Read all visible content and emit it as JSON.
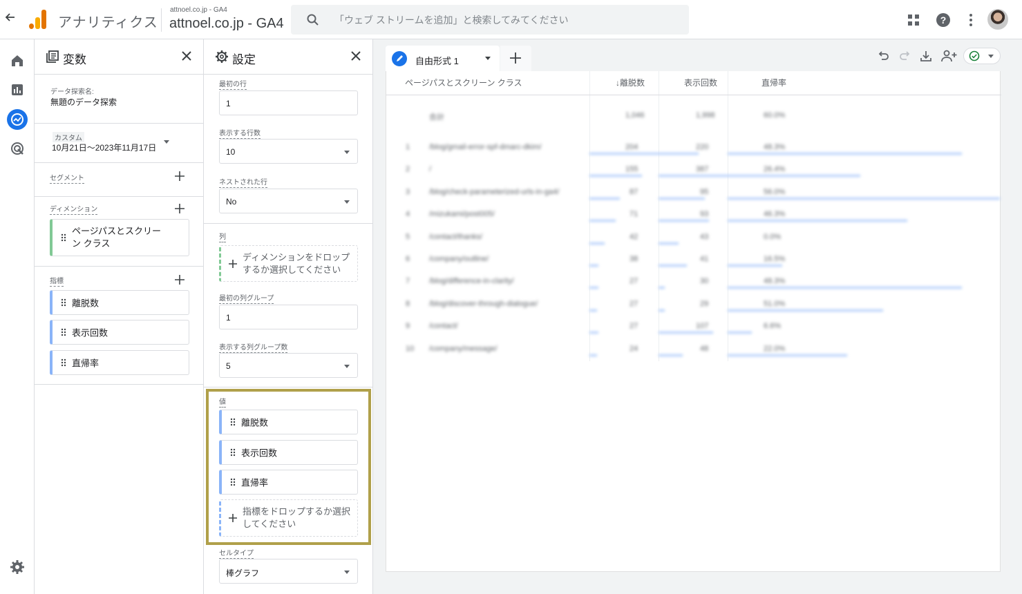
{
  "topbar": {
    "app_name": "アナリティクス",
    "account_small": "attnoel.co.jp - GA4",
    "account_big": "attnoel.co.jp - GA4",
    "search_placeholder": "「ウェブ ストリームを追加」と検索してみてください"
  },
  "variables_panel": {
    "title": "変数",
    "exploration_name_label": "データ探索名:",
    "exploration_name": "無題のデータ探索",
    "date_label": "カスタム",
    "date_range": "10月21日～2023年11月17日",
    "segments_label": "セグメント",
    "dimensions_label": "ディメンション",
    "dimensions": [
      "ページパスとスクリーン クラス"
    ],
    "metrics_label": "指標",
    "metrics": [
      "離脱数",
      "表示回数",
      "直帰率"
    ]
  },
  "settings_panel": {
    "title": "設定",
    "first_row_label": "最初の行",
    "first_row_value": "1",
    "rows_shown_label": "表示する行数",
    "rows_shown_value": "10",
    "nested_rows_label": "ネストされた行",
    "nested_rows_value": "No",
    "columns_label": "列",
    "columns_drop_text": "ディメンションをドロップするか選択してください",
    "first_col_group_label": "最初の列グループ",
    "first_col_group_value": "1",
    "col_groups_shown_label": "表示する列グループ数",
    "col_groups_shown_value": "5",
    "values_label": "値",
    "values": [
      "離脱数",
      "表示回数",
      "直帰率"
    ],
    "values_drop_text": "指標をドロップするか選択してください",
    "cell_type_label": "セルタイプ",
    "cell_type_value": "棒グラフ"
  },
  "canvas": {
    "tab_label": "自由形式 1",
    "columns": [
      "ページパスとスクリーン クラス",
      "↓離脱数",
      "表示回数",
      "直帰率"
    ],
    "total_row": {
      "label": "合計",
      "exits": "1,046",
      "views": "1,998",
      "bounce": "60.0%"
    },
    "rows": [
      {
        "n": "1",
        "page": "/blog/gmail-error-spf-dmarc-dkim/",
        "exits": "204",
        "views": "220",
        "bounce": "48.3%",
        "exits_frac": 1.0,
        "views_frac": 0.0,
        "bounce_frac": 0.86
      },
      {
        "n": "2",
        "page": "/",
        "exits": "155",
        "views": "387",
        "bounce": "26.4%",
        "exits_frac": 0.48,
        "views_frac": 1.0,
        "bounce_frac": 0.47
      },
      {
        "n": "3",
        "page": "/blog/check-parameterized-urls-in-ga4/",
        "exits": "87",
        "views": "95",
        "bounce": "56.0%",
        "exits_frac": 0.28,
        "views_frac": 0.23,
        "bounce_frac": 1.0
      },
      {
        "n": "4",
        "page": "/mizukami/post005/",
        "exits": "71",
        "views": "93",
        "bounce": "46.3%",
        "exits_frac": 0.24,
        "views_frac": 0.25,
        "bounce_frac": 0.66
      },
      {
        "n": "5",
        "page": "/contact/thanks/",
        "exits": "42",
        "views": "43",
        "bounce": "0.0%",
        "exits_frac": 0.14,
        "views_frac": 0.1,
        "bounce_frac": 0.0
      },
      {
        "n": "6",
        "page": "/company/outline/",
        "exits": "38",
        "views": "41",
        "bounce": "16.5%",
        "exits_frac": 0.08,
        "views_frac": 0.14,
        "bounce_frac": 0.2
      },
      {
        "n": "7",
        "page": "/blog/difference-in-clarity/",
        "exits": "27",
        "views": "30",
        "bounce": "48.3%",
        "exits_frac": 0.08,
        "views_frac": 0.03,
        "bounce_frac": 0.86
      },
      {
        "n": "8",
        "page": "/blog/discover-through-dialogue/",
        "exits": "27",
        "views": "29",
        "bounce": "51.0%",
        "exits_frac": 0.07,
        "views_frac": 0.03,
        "bounce_frac": 0.57
      },
      {
        "n": "9",
        "page": "/contact/",
        "exits": "27",
        "views": "107",
        "bounce": "6.6%",
        "exits_frac": 0.08,
        "views_frac": 0.27,
        "bounce_frac": 0.09
      },
      {
        "n": "10",
        "page": "/company/message/",
        "exits": "24",
        "views": "48",
        "bounce": "22.0%",
        "exits_frac": 0.07,
        "views_frac": 0.12,
        "bounce_frac": 0.44
      }
    ]
  }
}
